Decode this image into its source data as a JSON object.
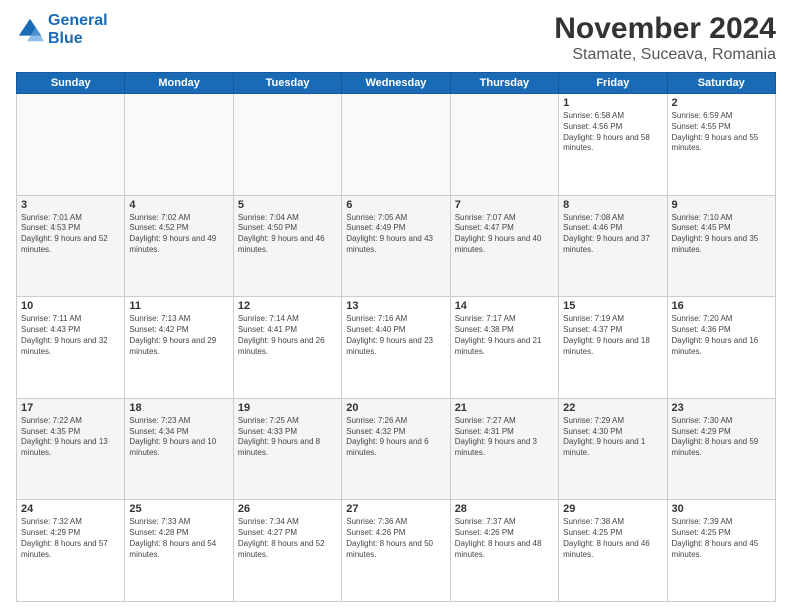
{
  "logo": {
    "line1": "General",
    "line2": "Blue"
  },
  "title": "November 2024",
  "subtitle": "Stamate, Suceava, Romania",
  "days_of_week": [
    "Sunday",
    "Monday",
    "Tuesday",
    "Wednesday",
    "Thursday",
    "Friday",
    "Saturday"
  ],
  "weeks": [
    [
      {
        "day": "",
        "info": ""
      },
      {
        "day": "",
        "info": ""
      },
      {
        "day": "",
        "info": ""
      },
      {
        "day": "",
        "info": ""
      },
      {
        "day": "",
        "info": ""
      },
      {
        "day": "1",
        "info": "Sunrise: 6:58 AM\nSunset: 4:56 PM\nDaylight: 9 hours and 58 minutes."
      },
      {
        "day": "2",
        "info": "Sunrise: 6:59 AM\nSunset: 4:55 PM\nDaylight: 9 hours and 55 minutes."
      }
    ],
    [
      {
        "day": "3",
        "info": "Sunrise: 7:01 AM\nSunset: 4:53 PM\nDaylight: 9 hours and 52 minutes."
      },
      {
        "day": "4",
        "info": "Sunrise: 7:02 AM\nSunset: 4:52 PM\nDaylight: 9 hours and 49 minutes."
      },
      {
        "day": "5",
        "info": "Sunrise: 7:04 AM\nSunset: 4:50 PM\nDaylight: 9 hours and 46 minutes."
      },
      {
        "day": "6",
        "info": "Sunrise: 7:05 AM\nSunset: 4:49 PM\nDaylight: 9 hours and 43 minutes."
      },
      {
        "day": "7",
        "info": "Sunrise: 7:07 AM\nSunset: 4:47 PM\nDaylight: 9 hours and 40 minutes."
      },
      {
        "day": "8",
        "info": "Sunrise: 7:08 AM\nSunset: 4:46 PM\nDaylight: 9 hours and 37 minutes."
      },
      {
        "day": "9",
        "info": "Sunrise: 7:10 AM\nSunset: 4:45 PM\nDaylight: 9 hours and 35 minutes."
      }
    ],
    [
      {
        "day": "10",
        "info": "Sunrise: 7:11 AM\nSunset: 4:43 PM\nDaylight: 9 hours and 32 minutes."
      },
      {
        "day": "11",
        "info": "Sunrise: 7:13 AM\nSunset: 4:42 PM\nDaylight: 9 hours and 29 minutes."
      },
      {
        "day": "12",
        "info": "Sunrise: 7:14 AM\nSunset: 4:41 PM\nDaylight: 9 hours and 26 minutes."
      },
      {
        "day": "13",
        "info": "Sunrise: 7:16 AM\nSunset: 4:40 PM\nDaylight: 9 hours and 23 minutes."
      },
      {
        "day": "14",
        "info": "Sunrise: 7:17 AM\nSunset: 4:38 PM\nDaylight: 9 hours and 21 minutes."
      },
      {
        "day": "15",
        "info": "Sunrise: 7:19 AM\nSunset: 4:37 PM\nDaylight: 9 hours and 18 minutes."
      },
      {
        "day": "16",
        "info": "Sunrise: 7:20 AM\nSunset: 4:36 PM\nDaylight: 9 hours and 16 minutes."
      }
    ],
    [
      {
        "day": "17",
        "info": "Sunrise: 7:22 AM\nSunset: 4:35 PM\nDaylight: 9 hours and 13 minutes."
      },
      {
        "day": "18",
        "info": "Sunrise: 7:23 AM\nSunset: 4:34 PM\nDaylight: 9 hours and 10 minutes."
      },
      {
        "day": "19",
        "info": "Sunrise: 7:25 AM\nSunset: 4:33 PM\nDaylight: 9 hours and 8 minutes."
      },
      {
        "day": "20",
        "info": "Sunrise: 7:26 AM\nSunset: 4:32 PM\nDaylight: 9 hours and 6 minutes."
      },
      {
        "day": "21",
        "info": "Sunrise: 7:27 AM\nSunset: 4:31 PM\nDaylight: 9 hours and 3 minutes."
      },
      {
        "day": "22",
        "info": "Sunrise: 7:29 AM\nSunset: 4:30 PM\nDaylight: 9 hours and 1 minute."
      },
      {
        "day": "23",
        "info": "Sunrise: 7:30 AM\nSunset: 4:29 PM\nDaylight: 8 hours and 59 minutes."
      }
    ],
    [
      {
        "day": "24",
        "info": "Sunrise: 7:32 AM\nSunset: 4:29 PM\nDaylight: 8 hours and 57 minutes."
      },
      {
        "day": "25",
        "info": "Sunrise: 7:33 AM\nSunset: 4:28 PM\nDaylight: 8 hours and 54 minutes."
      },
      {
        "day": "26",
        "info": "Sunrise: 7:34 AM\nSunset: 4:27 PM\nDaylight: 8 hours and 52 minutes."
      },
      {
        "day": "27",
        "info": "Sunrise: 7:36 AM\nSunset: 4:26 PM\nDaylight: 8 hours and 50 minutes."
      },
      {
        "day": "28",
        "info": "Sunrise: 7:37 AM\nSunset: 4:26 PM\nDaylight: 8 hours and 48 minutes."
      },
      {
        "day": "29",
        "info": "Sunrise: 7:38 AM\nSunset: 4:25 PM\nDaylight: 8 hours and 46 minutes."
      },
      {
        "day": "30",
        "info": "Sunrise: 7:39 AM\nSunset: 4:25 PM\nDaylight: 8 hours and 45 minutes."
      }
    ]
  ]
}
